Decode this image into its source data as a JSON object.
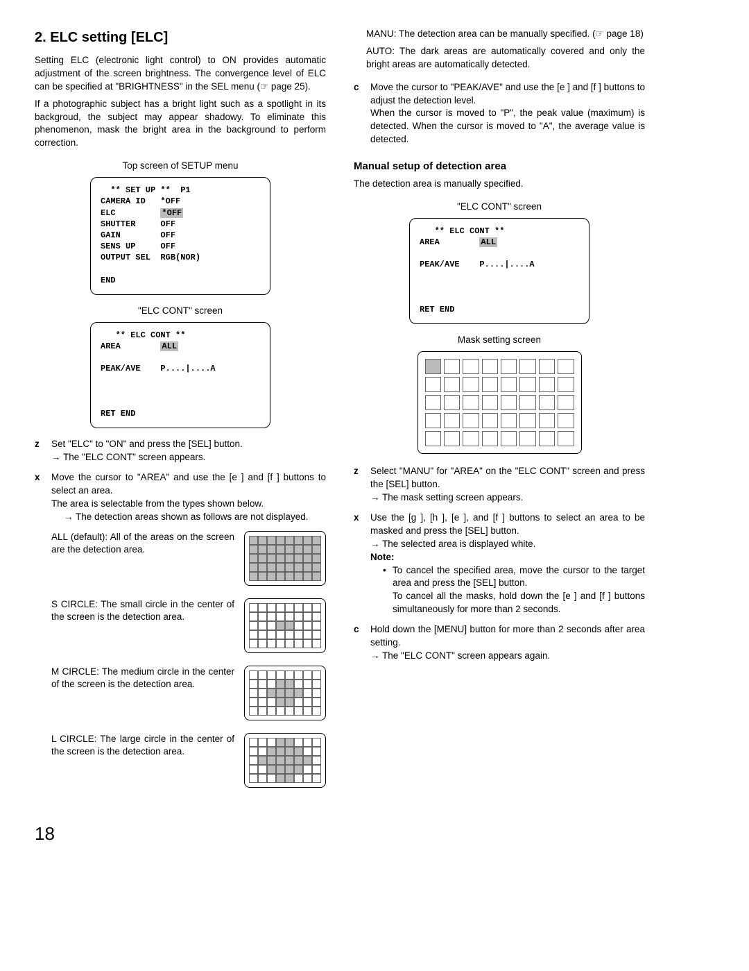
{
  "section": {
    "title": "2. ELC setting [ELC]",
    "para1": "Setting ELC (electronic light control) to ON provides automatic adjustment of the screen brightness. The convergence level of ELC can be specified at \"BRIGHTNESS\" in the SEL menu (☞ page 25).",
    "para2": "If a photographic subject has a bright light such as a spotlight in its backgroud, the subject may appear shadowy. To eliminate this phenomenon, mask the bright area in the background to perform correction."
  },
  "captions": {
    "setup_top": "Top screen of SETUP menu",
    "elc_cont": "\"ELC CONT\" screen",
    "mask": "Mask setting screen"
  },
  "setup_screen": {
    "header": "  ** SET UP **  P1",
    "rows": [
      {
        "label": "CAMERA ID",
        "value": "*OFF"
      },
      {
        "label": "ELC",
        "value": "*OFF",
        "hl": true
      },
      {
        "label": "SHUTTER",
        "value": "OFF"
      },
      {
        "label": "GAIN",
        "value": "OFF"
      },
      {
        "label": "SENS UP",
        "value": "OFF"
      },
      {
        "label": "OUTPUT SEL",
        "value": "RGB(NOR)"
      }
    ],
    "end": "END"
  },
  "elc_screen": {
    "header": "   ** ELC CONT **",
    "area_label": "AREA",
    "area_value": "ALL",
    "peak_label": "PEAK/AVE",
    "peak_value": "P....|....A",
    "ret": "RET END"
  },
  "steps_left": {
    "z": {
      "mark": "z",
      "line1": "Set \"ELC\" to \"ON\" and press the [SEL] button.",
      "line2": "The \"ELC CONT\" screen appears."
    },
    "x": {
      "mark": "x",
      "line1": "Move the cursor to \"AREA\" and use the [e ] and [f ] buttons to select an area.",
      "line2": "The area is selectable from the types shown below.",
      "line3": "The detection areas shown as follows are not displayed."
    }
  },
  "areas": {
    "all": "ALL (default): All of the areas on the screen are the detection area.",
    "s": "S CIRCLE: The small circle in the center of the screen is the detection area.",
    "m": "M CIRCLE: The medium circle in the center of the screen is the detection area.",
    "l": "L CIRCLE: The large circle in the center of the screen is the detection area."
  },
  "right_top": {
    "manu": "MANU: The detection area can be manually specified. (☞ page 18)",
    "auto": "AUTO: The dark areas are automatically covered and only the bright areas are automatically detected."
  },
  "steps_right_c": {
    "mark": "c",
    "line1": "Move the cursor to \"PEAK/AVE\" and use the [e ] and [f ] buttons to adjust the detection level.",
    "line2": "When the cursor is moved to \"P\", the peak value (maximum) is detected. When the cursor is moved to \"A\", the average value is detected."
  },
  "manual": {
    "title": "Manual setup of detection area",
    "intro": "The detection area is manually specified.",
    "z": {
      "mark": "z",
      "line1": "Select \"MANU\" for \"AREA\" on the \"ELC CONT\" screen and press the [SEL] button.",
      "line2": "The mask setting screen appears."
    },
    "x": {
      "mark": "x",
      "line1": "Use the [g ], [h ], [e ], and [f ] buttons to select an area to be masked and press the [SEL] button.",
      "line2": "The selected area is displayed white.",
      "note_label": "Note:",
      "note1": "To cancel the specified area, move the cursor to the target area and press the [SEL] button.",
      "note2": "To cancel all the masks, hold down the [e ] and [f ] buttons simultaneously for more than 2 seconds."
    },
    "c": {
      "mark": "c",
      "line1": "Hold down the [MENU] button for more than 2 seconds after area setting.",
      "line2": "The \"ELC CONT\" screen appears again."
    }
  },
  "page_number": "18"
}
